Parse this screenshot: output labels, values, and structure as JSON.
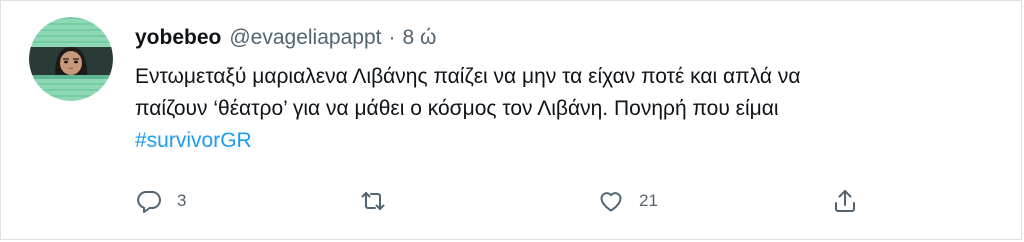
{
  "tweet": {
    "display_name": "yobebeo",
    "handle": "@evageliapappt",
    "separator": "·",
    "timestamp": "8 ώ",
    "text_lines": [
      "Εντωμεταξύ μαριαλενα Λιβάνης παίζει να μην τα είχαν ποτέ και απλά να",
      "παίζουν ‘θέατρο’ για να μάθει ο κόσμος τον Λιβάνη. Πονηρή που είμαι"
    ],
    "hashtag": "#survivorGR",
    "avatar": {
      "description_icon": "profile-avatar",
      "background_color": "#8ed8b6",
      "stripe_color": "#6cc69c"
    },
    "actions": {
      "reply": {
        "icon": "reply-icon",
        "count": "3"
      },
      "retweet": {
        "icon": "retweet-icon",
        "count": ""
      },
      "like": {
        "icon": "heart-icon",
        "count": "21"
      },
      "share": {
        "icon": "share-icon",
        "count": ""
      }
    }
  },
  "colors": {
    "text_primary": "#0f1419",
    "text_secondary": "#536471",
    "link": "#1d9bf0",
    "border": "#dfe3e6"
  }
}
